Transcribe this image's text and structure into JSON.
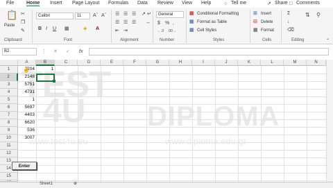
{
  "tabs": [
    "File",
    "Home",
    "Insert",
    "Page Layout",
    "Formulas",
    "Data",
    "Review",
    "View",
    "Help",
    "Tell me",
    "Share",
    "Comments"
  ],
  "ribbon": {
    "paste": "Paste",
    "font_name": "Calibri",
    "font_size": "11",
    "number_format": "General",
    "conditional_formatting": "Conditional Formatting",
    "format_as_table": "Format as Table",
    "cell_styles": "Cell Styles",
    "insert": "Insert",
    "delete": "Delete",
    "format": "Format",
    "groups": [
      "Clipboard",
      "Font",
      "Alignment",
      "Number",
      "Styles",
      "Cells",
      "Editing"
    ]
  },
  "formula_bar": {
    "name_box": "B2",
    "fx": "fx",
    "formula": ""
  },
  "columns": [
    "A",
    "B",
    "C",
    "D",
    "E",
    "F",
    "G",
    "H",
    "I",
    "J",
    "K",
    "L",
    "M",
    "N"
  ],
  "rows": [
    "1",
    "2",
    "3",
    "4",
    "5",
    "6",
    "7",
    "8",
    "9",
    "10",
    "11",
    "12",
    "13",
    "14",
    "15",
    "16"
  ],
  "cells": {
    "A1": "2204",
    "B1": "1",
    "A2": "2148",
    "A3": "5751",
    "A4": "4731",
    "A5": "1",
    "A6": "5697",
    "A7": "4403",
    "A8": "6620",
    "A9": "536",
    "A10": "3007"
  },
  "watermark": {
    "logo_top": "TEST",
    "logo_bottom": "4U",
    "brand": "DIPLOMA",
    "url_left": "www.test4u.eu",
    "url_right": "www.diploma.edu.gr"
  },
  "enter_button": "Enter",
  "sheet_tab": "Sheet1"
}
